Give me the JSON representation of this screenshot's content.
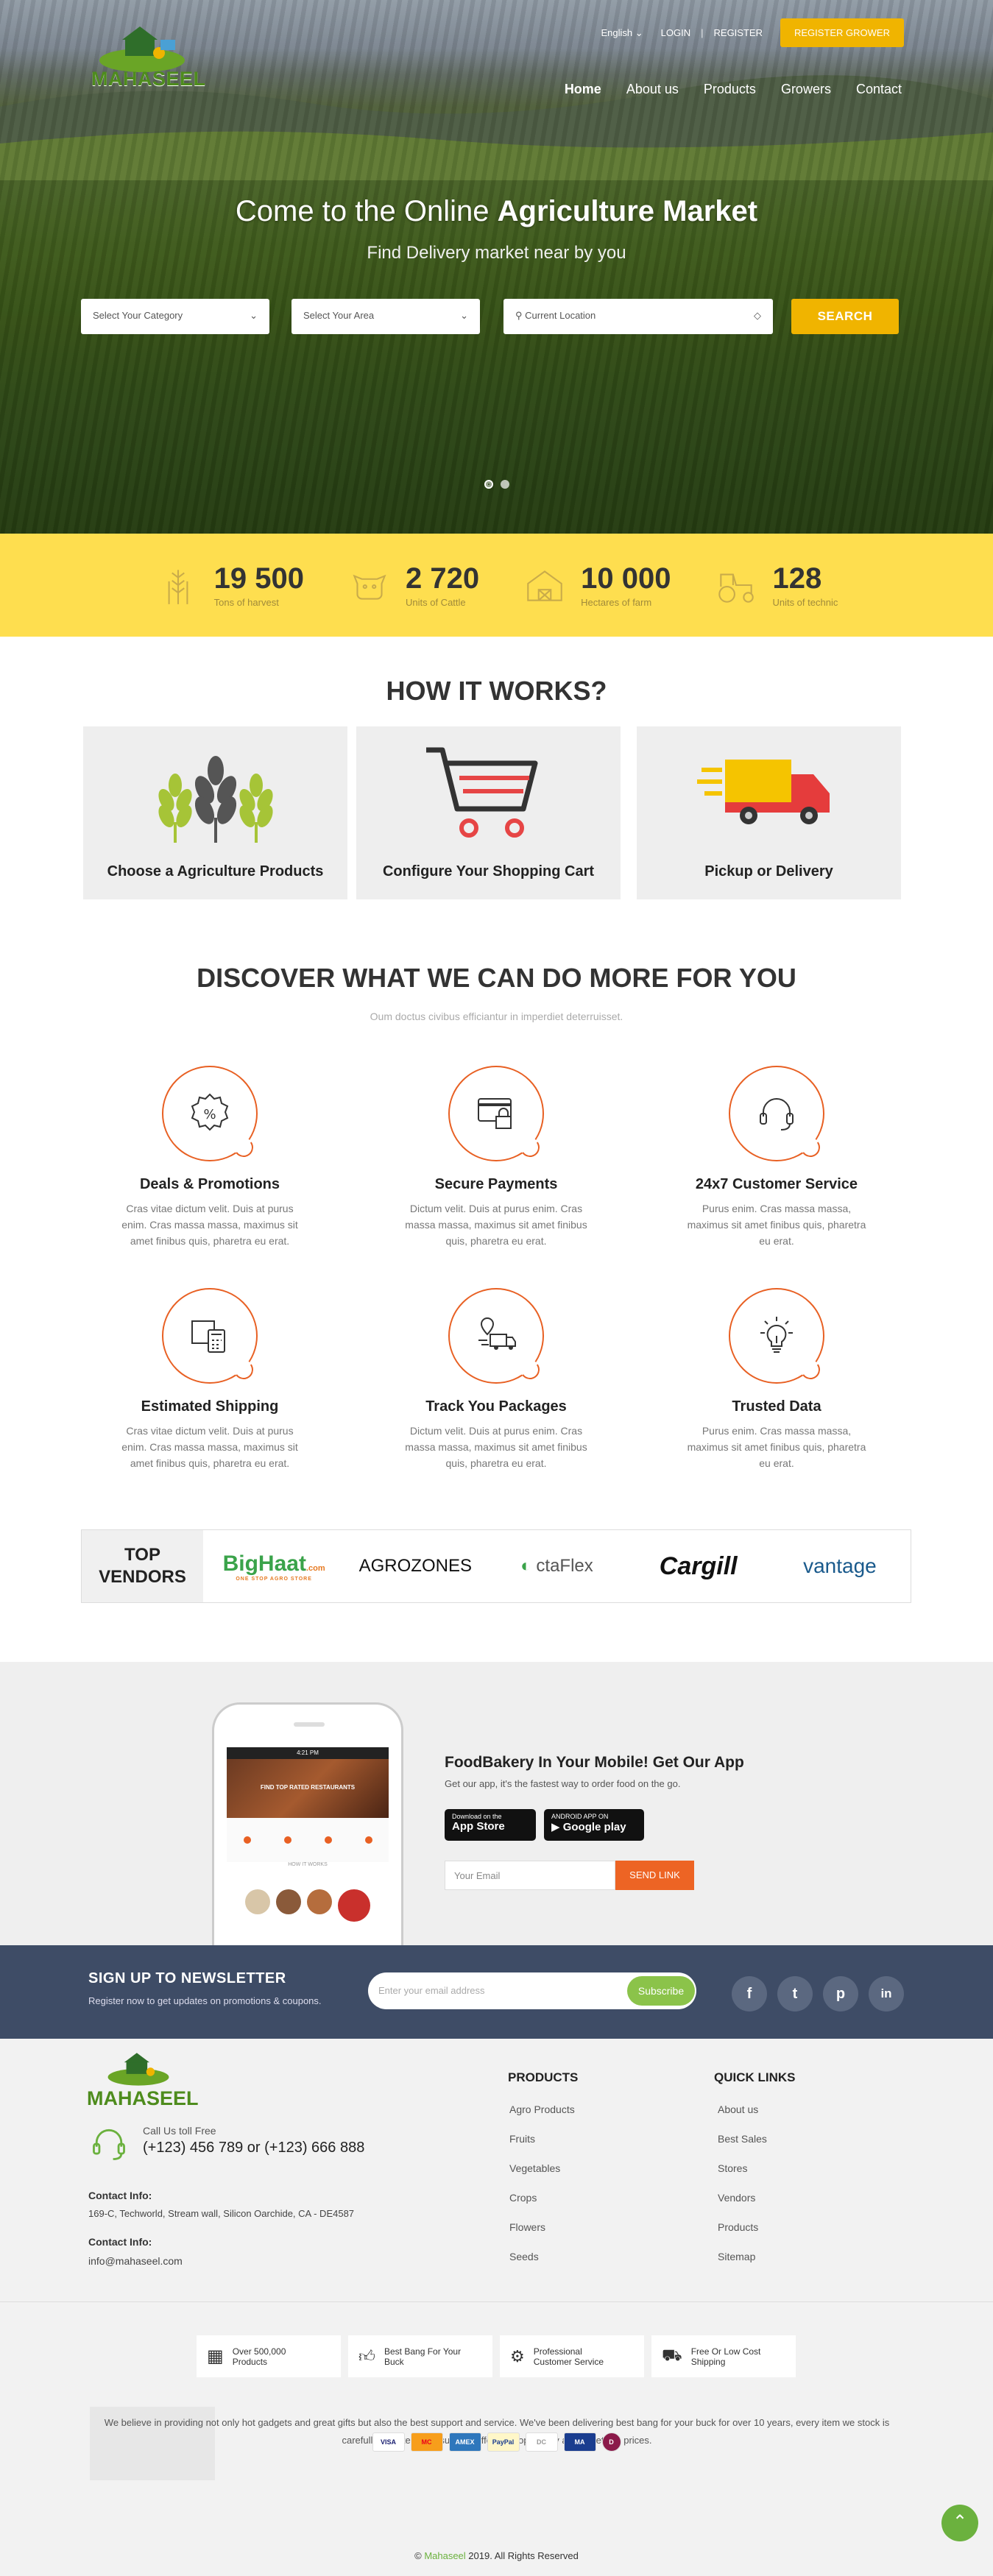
{
  "brand": {
    "name": "MAHASEEL"
  },
  "topbar": {
    "language": "English",
    "login": "LOGIN",
    "separator": "|",
    "register": "REGISTER",
    "register_grower": "REGISTER GROWER"
  },
  "nav": [
    {
      "label": "Home"
    },
    {
      "label": "About us"
    },
    {
      "label": "Products"
    },
    {
      "label": "Growers"
    },
    {
      "label": "Contact"
    }
  ],
  "hero": {
    "title_prefix": "Come to the Online ",
    "title_bold": "Agriculture Market",
    "subtitle": "Find Delivery market near by you",
    "category_placeholder": "Select Your Category",
    "area_placeholder": "Select Your Area",
    "location_placeholder": "Current Location",
    "search_label": "SEARCH"
  },
  "stats": [
    {
      "value": "19 500",
      "label": "Tons of harvest",
      "icon": "wheat-icon"
    },
    {
      "value": "2 720",
      "label": "Units of Cattle",
      "icon": "cow-icon"
    },
    {
      "value": "10 000",
      "label": "Hectares of farm",
      "icon": "barn-icon"
    },
    {
      "value": "128",
      "label": "Units of technic",
      "icon": "tractor-icon"
    }
  ],
  "how": {
    "title": "HOW IT WORKS?",
    "steps": [
      {
        "label": "Choose a Agriculture Products",
        "icon": "wheat-icon"
      },
      {
        "label": "Configure Your Shopping Cart",
        "icon": "cart-icon"
      },
      {
        "label": "Pickup or Delivery",
        "icon": "truck-icon"
      }
    ]
  },
  "discover": {
    "title": "DISCOVER WHAT WE CAN DO MORE FOR YOU",
    "subtitle": "Oum doctus civibus efficiantur in imperdiet deterruisset.",
    "services": [
      {
        "title": "Deals & Promotions",
        "text": "Cras vitae dictum velit. Duis at purus enim. Cras massa massa, maximus sit amet finibus quis, pharetra eu erat.",
        "icon": "discount-badge-icon"
      },
      {
        "title": "Secure Payments",
        "text": "Dictum velit. Duis at purus enim. Cras massa massa, maximus sit amet finibus quis, pharetra eu erat.",
        "icon": "secure-card-icon"
      },
      {
        "title": "24x7 Customer Service",
        "text": "Purus enim. Cras massa massa, maximus sit amet finibus quis, pharetra eu erat.",
        "icon": "headset-icon"
      },
      {
        "title": "Estimated Shipping",
        "text": "Cras vitae dictum velit. Duis at purus enim. Cras massa massa, maximus sit amet finibus quis, pharetra eu erat.",
        "icon": "calculator-box-icon"
      },
      {
        "title": "Track You Packages",
        "text": "Dictum velit. Duis at purus enim. Cras massa massa, maximus sit amet finibus quis, pharetra eu erat.",
        "icon": "delivery-track-icon"
      },
      {
        "title": "Trusted Data",
        "text": "Purus enim. Cras massa massa, maximus sit amet finibus quis, pharetra eu erat.",
        "icon": "lightbulb-icon"
      }
    ]
  },
  "vendors": {
    "title_line1": "TOP",
    "title_line2": "VENDORS",
    "logos": [
      "BigHaat",
      "AGROZONES",
      "ctaFlex",
      "Cargill",
      "vantage"
    ],
    "bighaat_tag": ".com",
    "bighaat_sub": "ONE STOP AGRO STORE"
  },
  "app": {
    "title": "FoodBakery In Your Mobile! Get Our App",
    "text": "Get our app, it's the fastest way to order food on the go.",
    "appstore_small": "Download on the",
    "appstore": "App Store",
    "googleplay_small": "ANDROID APP ON",
    "googleplay": "Google play",
    "email_placeholder": "Your Email",
    "send": "SEND LINK",
    "screen_status": "4:21 PM",
    "screen_title": "FIND TOP RATED RESTAURANTS",
    "screen_sub": "HOW IT WORKS"
  },
  "newsletter": {
    "title": "SIGN UP TO NEWSLETTER",
    "text": "Register now to get updates on promotions & coupons.",
    "placeholder": "Enter your email address",
    "button": "Subscribe",
    "social": [
      "f",
      "t",
      "p",
      "in"
    ]
  },
  "footer": {
    "call_label": "Call Us toll Free",
    "phone": "(+123) 456 789 or (+123) 666 888",
    "contact_label": "Contact Info:",
    "address": "169-C, Techworld, Stream wall, Silicon Oarchide, CA - DE4587",
    "email_label": "Contact Info:",
    "email": "info@mahaseel.com",
    "products_title": "PRODUCTS",
    "products": [
      "Agro Products",
      "Fruits",
      "Vegetables",
      "Crops",
      "Flowers",
      "Seeds"
    ],
    "links_title": "QUICK LINKS",
    "links": [
      "About us",
      "Best Sales",
      "Stores",
      "Vendors",
      "Products",
      "Sitemap"
    ],
    "features": [
      {
        "line1": "Over 500,000",
        "line2": "Products",
        "icon": "boxes-icon"
      },
      {
        "line1": "Best Bang For Your",
        "line2": "Buck",
        "icon": "thumbs-up-icon"
      },
      {
        "line1": "Professional",
        "line2": "Customer Service",
        "icon": "gears-icon"
      },
      {
        "line1": "Free Or Low Cost",
        "line2": "Shipping",
        "icon": "truck-icon"
      }
    ],
    "about": "We believe in providing not only hot gadgets and great gifts but also the best support and service. We've been delivering best bang for your buck for over 10 years, every item we stock is carefully selected to ensure we offer you top quality at competitive prices.",
    "cards": [
      "VISA",
      "MC",
      "AMEX",
      "PayPal",
      "DC",
      "MA",
      "D"
    ],
    "copyright_brand": "Mahaseel",
    "copyright_rest": " 2019. All Rights Reserved"
  },
  "colors": {
    "accent": "#f0b400",
    "orange": "#e86023",
    "green": "#6bb13e",
    "stats_bg": "#fede4f",
    "newsletter_bg": "#3e4c66"
  }
}
